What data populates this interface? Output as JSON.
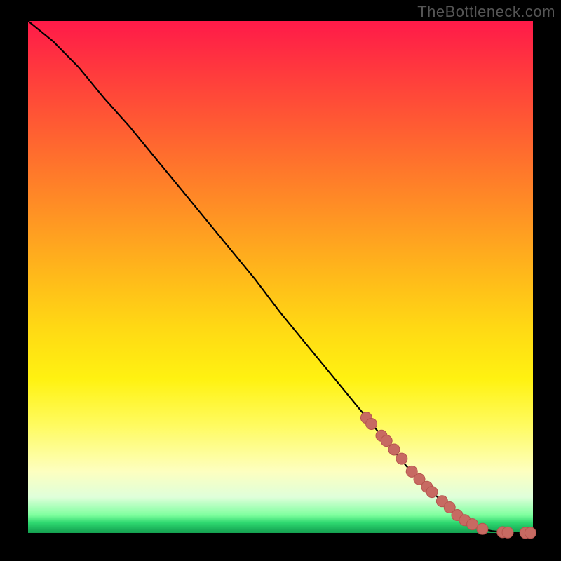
{
  "watermark": "TheBottleneck.com",
  "chart_data": {
    "type": "line",
    "title": "",
    "xlabel": "",
    "ylabel": "",
    "xlim": [
      0,
      100
    ],
    "ylim": [
      0,
      100
    ],
    "series": [
      {
        "name": "curve",
        "x": [
          0,
          5,
          10,
          15,
          20,
          25,
          30,
          35,
          40,
          45,
          50,
          55,
          60,
          65,
          70,
          75,
          80,
          85,
          88,
          90,
          92,
          94,
          96,
          98,
          100
        ],
        "y": [
          100,
          96,
          91,
          85,
          79.5,
          73.5,
          67.5,
          61.5,
          55.5,
          49.5,
          43,
          37,
          31,
          25,
          19,
          13,
          8,
          3.5,
          1.7,
          0.8,
          0.35,
          0.15,
          0.08,
          0.03,
          0
        ]
      }
    ],
    "markers": [
      {
        "x": 67,
        "y": 22.5
      },
      {
        "x": 68,
        "y": 21.3
      },
      {
        "x": 70,
        "y": 19
      },
      {
        "x": 71,
        "y": 18
      },
      {
        "x": 72.5,
        "y": 16.3
      },
      {
        "x": 74,
        "y": 14.5
      },
      {
        "x": 76,
        "y": 12
      },
      {
        "x": 77.5,
        "y": 10.5
      },
      {
        "x": 79,
        "y": 9
      },
      {
        "x": 80,
        "y": 8
      },
      {
        "x": 82,
        "y": 6.2
      },
      {
        "x": 83.5,
        "y": 5
      },
      {
        "x": 85,
        "y": 3.5
      },
      {
        "x": 86.5,
        "y": 2.5
      },
      {
        "x": 88,
        "y": 1.7
      },
      {
        "x": 90,
        "y": 0.8
      },
      {
        "x": 94,
        "y": 0.15
      },
      {
        "x": 95,
        "y": 0.1
      },
      {
        "x": 98.5,
        "y": 0.02
      },
      {
        "x": 99.5,
        "y": 0.01
      }
    ],
    "gradient_stops": [
      {
        "pct": 0,
        "color": "#ff1a49"
      },
      {
        "pct": 50,
        "color": "#ffba1a"
      },
      {
        "pct": 80,
        "color": "#fffb60"
      },
      {
        "pct": 100,
        "color": "#159f50"
      }
    ]
  }
}
